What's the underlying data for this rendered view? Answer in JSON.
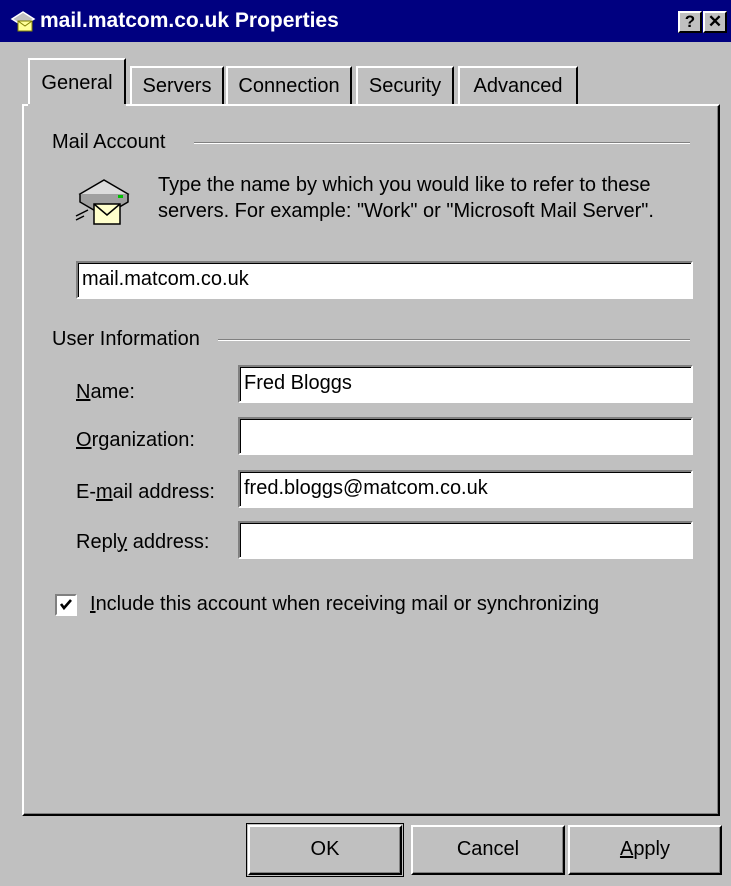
{
  "window": {
    "title": "mail.matcom.co.uk Properties",
    "help_button": "?",
    "close_button": "✕"
  },
  "tabs": [
    {
      "label": "General",
      "active": true
    },
    {
      "label": "Servers",
      "active": false
    },
    {
      "label": "Connection",
      "active": false
    },
    {
      "label": "Security",
      "active": false
    },
    {
      "label": "Advanced",
      "active": false
    }
  ],
  "mail_account": {
    "heading": "Mail Account",
    "description": "Type the name by which you would like to refer to these servers.  For example: \"Work\" or \"Microsoft Mail Server\".",
    "account_name": "mail.matcom.co.uk",
    "icon": "mail-server-icon"
  },
  "user_information": {
    "heading": "User Information",
    "name_label": "Name:",
    "name_value": "Fred Bloggs",
    "organization_label": "Organization:",
    "organization_value": "",
    "email_label": "E-mail address:",
    "email_value": "fred.bloggs@matcom.co.uk",
    "reply_label": "Reply address:",
    "reply_value": ""
  },
  "include_account": {
    "checked": true,
    "label": "Include this account when receiving mail or synchronizing"
  },
  "buttons": {
    "ok": "OK",
    "cancel": "Cancel",
    "apply": "Apply"
  },
  "colors": {
    "title_bar": "#000080",
    "face": "#c0c0c0",
    "field": "#ffffff"
  }
}
